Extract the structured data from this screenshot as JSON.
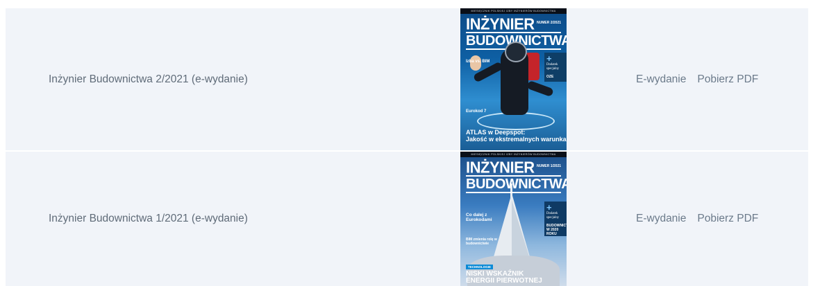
{
  "issues": [
    {
      "title": "Inżynier Budownictwa 2/2021 (e-wydanie)",
      "link_ewydanie": "E-wydanie",
      "link_pdf": "Pobierz PDF",
      "cover": {
        "strip": "MIESIĘCZNIK POLSKIEJ IZBY INŻYNIERÓW BUDOWNICTWA",
        "masthead_1": "INŻYNIER",
        "masthead_2": "BUDOWNICTWA",
        "issue_no": "NUMER 2/2021",
        "supplement": "Dodatek specjalny",
        "supplement_tag": "OZE",
        "side_note_1": "Izba vs. BIM",
        "side_note_2": "Eurokod 7",
        "headline_1": "ATLAS w Deepspot:",
        "headline_2": "Jakość w ekstremalnych warunkach"
      }
    },
    {
      "title": "Inżynier Budownictwa 1/2021 (e-wydanie)",
      "link_ewydanie": "E-wydanie",
      "link_pdf": "Pobierz PDF",
      "cover": {
        "strip": "MIESIĘCZNIK POLSKIEJ IZBY INŻYNIERÓW BUDOWNICTWA",
        "masthead_1": "INŻYNIER",
        "masthead_2": "BUDOWNICTWA",
        "issue_no": "NUMER 1/2021",
        "supplement": "Dodatek specjalny",
        "supplement_tag": "BUDOWNICTWO W 2020 ROKU",
        "side_note_1": "Co dalej z Eurokodami",
        "side_note_2": "BIM zmienia rolę w budownictwie",
        "tag": "TECHNOLOGIE",
        "headline_1": "NISKI WSKAŹNIK",
        "headline_2": "ENERGII PIERWOTNEJ"
      }
    }
  ]
}
